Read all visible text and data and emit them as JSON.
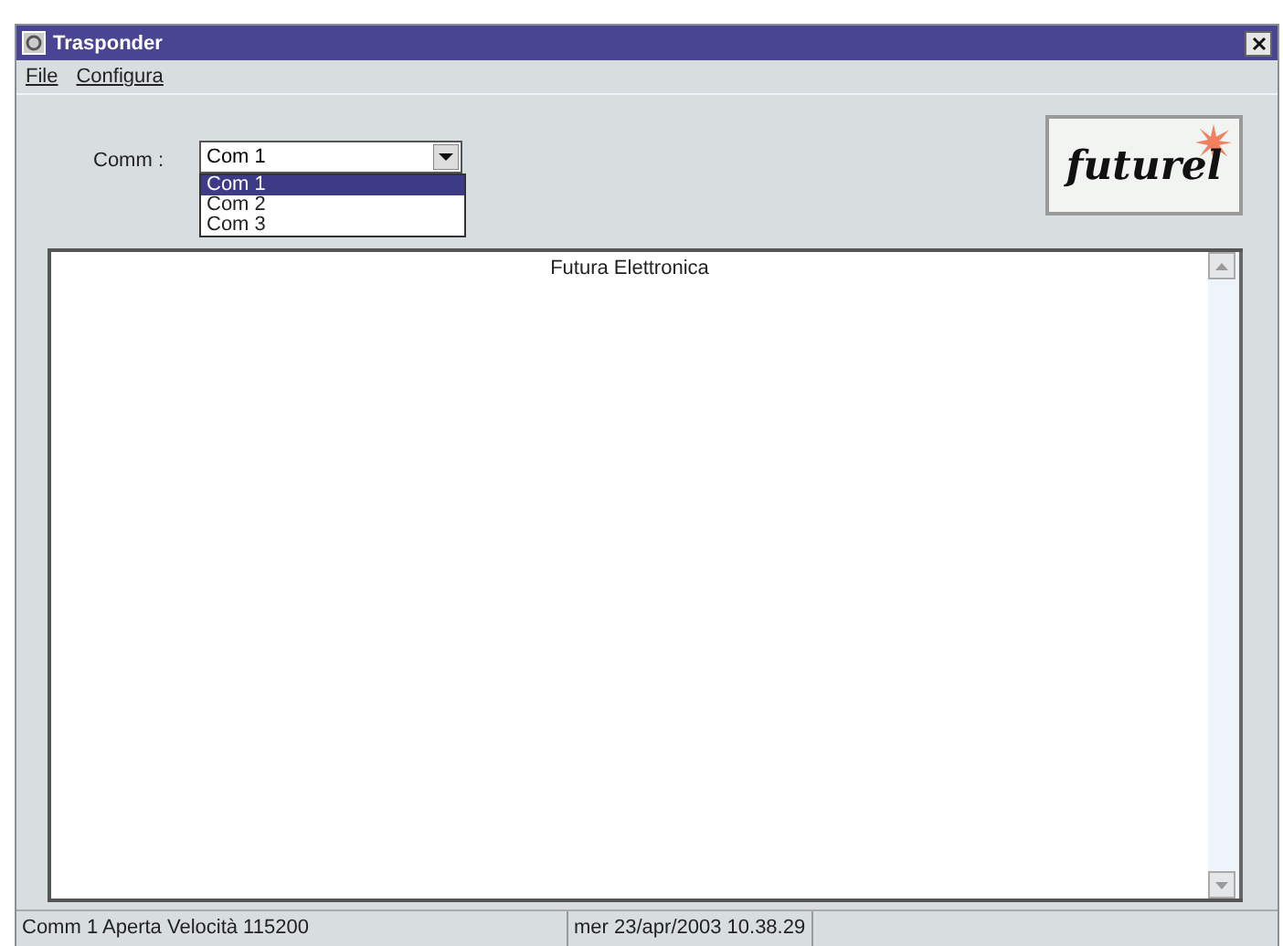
{
  "window": {
    "title": "Trasponder"
  },
  "menu": [
    {
      "label": "File"
    },
    {
      "label": "Configura"
    }
  ],
  "comm": {
    "label": "Comm :",
    "value": "Com 1",
    "expanded": true,
    "options": [
      {
        "label": "Com 1",
        "selected": true
      },
      {
        "label": "Com 2",
        "selected": false
      },
      {
        "label": "Com 3",
        "selected": false
      }
    ]
  },
  "logo": {
    "text": "futurel"
  },
  "output": {
    "lines": [
      "Futura Elettronica"
    ]
  },
  "status_bar": [
    "Comm 1 Aperta Velocità 115200",
    "mer 23/apr/2003 10.38.29"
  ]
}
